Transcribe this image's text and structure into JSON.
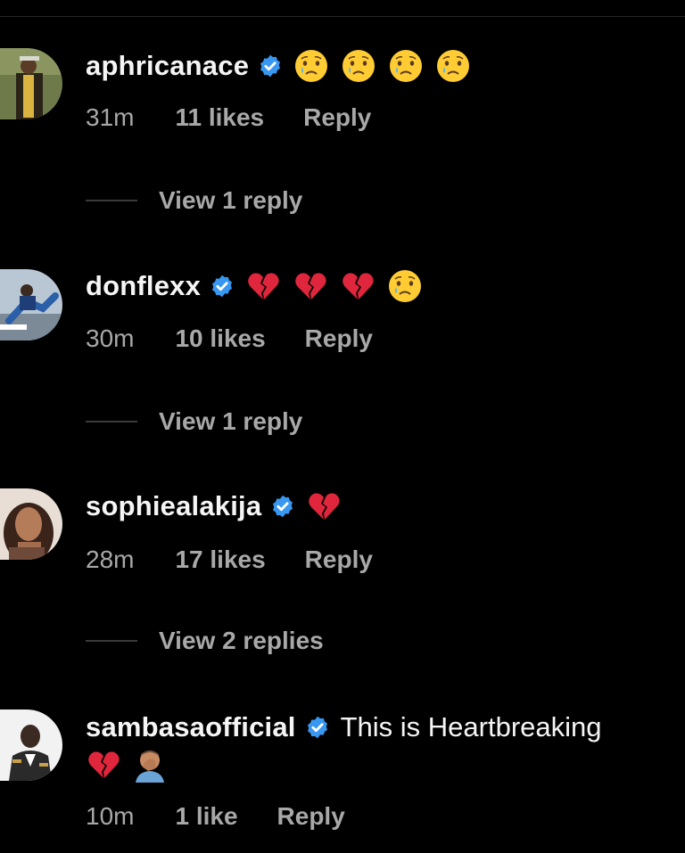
{
  "comments": [
    {
      "username": "aphricanace",
      "verified": true,
      "emojis": [
        "crying-face",
        "crying-face",
        "crying-face",
        "crying-face"
      ],
      "text": "",
      "time": "31m",
      "likes": "11 likes",
      "reply_label": "Reply",
      "view_replies": "View 1 reply"
    },
    {
      "username": "donflexx",
      "verified": true,
      "emojis": [
        "broken-heart",
        "broken-heart",
        "broken-heart",
        "crying-face"
      ],
      "text": "",
      "time": "30m",
      "likes": "10 likes",
      "reply_label": "Reply",
      "view_replies": "View 1 reply"
    },
    {
      "username": "sophiealakija",
      "verified": true,
      "emojis": [
        "broken-heart"
      ],
      "text": "",
      "time": "28m",
      "likes": "17 likes",
      "reply_label": "Reply",
      "view_replies": "View 2 replies"
    },
    {
      "username": "sambasaofficial",
      "verified": true,
      "text": "This is Heartbreaking",
      "emojis": [
        "broken-heart",
        "man-facepalming"
      ],
      "time": "10m",
      "likes": "1 like",
      "reply_label": "Reply"
    }
  ],
  "colors": {
    "background": "#000000",
    "primary_text": "#f5f5f5",
    "secondary_text": "#a8a8a8",
    "verified_blue": "#3897f0"
  }
}
